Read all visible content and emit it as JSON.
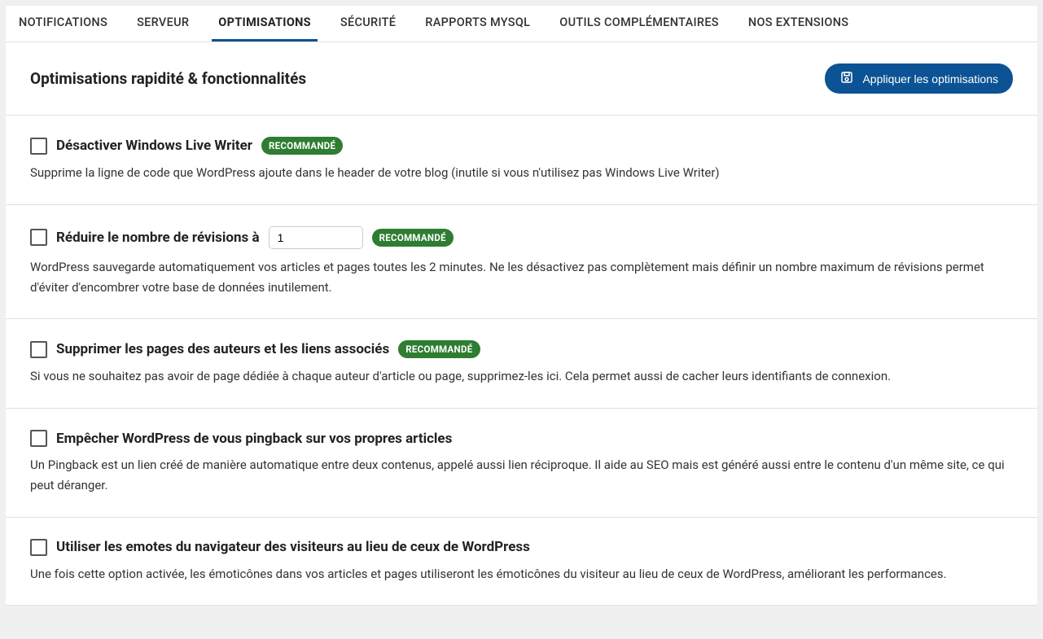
{
  "tabs": [
    {
      "label": "NOTIFICATIONS",
      "active": false
    },
    {
      "label": "SERVEUR",
      "active": false
    },
    {
      "label": "OPTIMISATIONS",
      "active": true
    },
    {
      "label": "SÉCURITÉ",
      "active": false
    },
    {
      "label": "RAPPORTS MYSQL",
      "active": false
    },
    {
      "label": "OUTILS COMPLÉMENTAIRES",
      "active": false
    },
    {
      "label": "NOS EXTENSIONS",
      "active": false
    }
  ],
  "header": {
    "title": "Optimisations rapidité & fonctionnalités",
    "apply_button": "Appliquer les optimisations"
  },
  "badge_text": "RECOMMANDÉ",
  "options": [
    {
      "title": "Désactiver Windows Live Writer",
      "recommended": true,
      "has_input": false,
      "desc": "Supprime la ligne de code que WordPress ajoute dans le header de votre blog (inutile si vous n'utilisez pas Windows Live Writer)"
    },
    {
      "title": "Réduire le nombre de révisions à",
      "recommended": true,
      "has_input": true,
      "input_value": "1",
      "desc": "WordPress sauvegarde automatiquement vos articles et pages toutes les 2 minutes. Ne les désactivez pas complètement mais définir un nombre maximum de révisions permet d'éviter d'encombrer votre base de données inutilement."
    },
    {
      "title": "Supprimer les pages des auteurs et les liens associés",
      "recommended": true,
      "has_input": false,
      "desc": "Si vous ne souhaitez pas avoir de page dédiée à chaque auteur d'article ou page, supprimez-les ici. Cela permet aussi de cacher leurs identifiants de connexion."
    },
    {
      "title": "Empêcher WordPress de vous pingback sur vos propres articles",
      "recommended": false,
      "has_input": false,
      "desc": "Un Pingback est un lien créé de manière automatique entre deux contenus, appelé aussi lien réciproque. Il aide au SEO mais est généré aussi entre le contenu d'un même site, ce qui peut déranger."
    },
    {
      "title": "Utiliser les emotes du navigateur des visiteurs au lieu de ceux de WordPress",
      "recommended": false,
      "has_input": false,
      "desc": "Une fois cette option activée, les émoticônes dans vos articles et pages utiliseront les émoticônes du visiteur au lieu de ceux de WordPress, améliorant les performances."
    }
  ]
}
